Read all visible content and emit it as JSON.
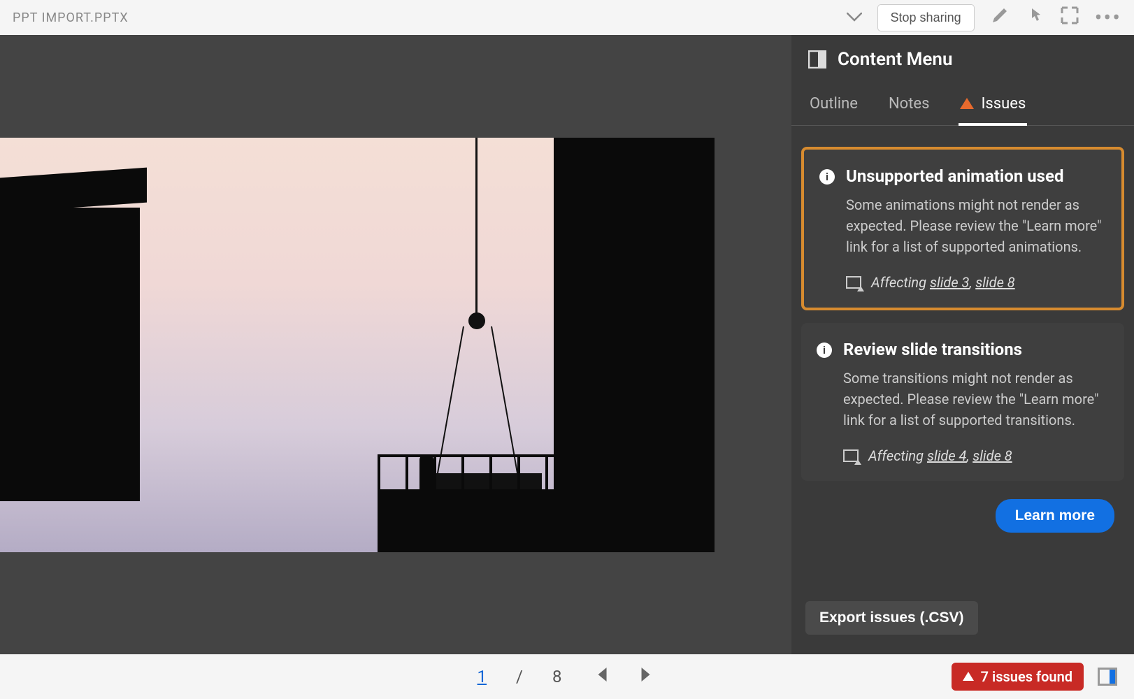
{
  "header": {
    "filename": "PPT IMPORT.PPTX",
    "stop_sharing": "Stop sharing"
  },
  "panel": {
    "title": "Content Menu",
    "tabs": {
      "outline": "Outline",
      "notes": "Notes",
      "issues": "Issues"
    }
  },
  "issues": [
    {
      "title": "Unsupported animation used",
      "description": "Some animations might not render as expected. Please review the \"Learn more\" link for a list of supported animations.",
      "affecting_label": "Affecting",
      "slides": [
        "slide 3",
        "slide 8"
      ],
      "highlighted": true
    },
    {
      "title": "Review slide transitions",
      "description": "Some transitions might not render as expected. Please review the \"Learn more\" link for a list of supported transitions.",
      "affecting_label": "Affecting",
      "slides": [
        "slide 4",
        "slide 8"
      ],
      "highlighted": false
    }
  ],
  "buttons": {
    "learn_more": "Learn more",
    "export": "Export issues (.CSV)"
  },
  "footer": {
    "current_page": "1",
    "separator": "/",
    "total_pages": "8",
    "issues_found": "7 issues found"
  }
}
